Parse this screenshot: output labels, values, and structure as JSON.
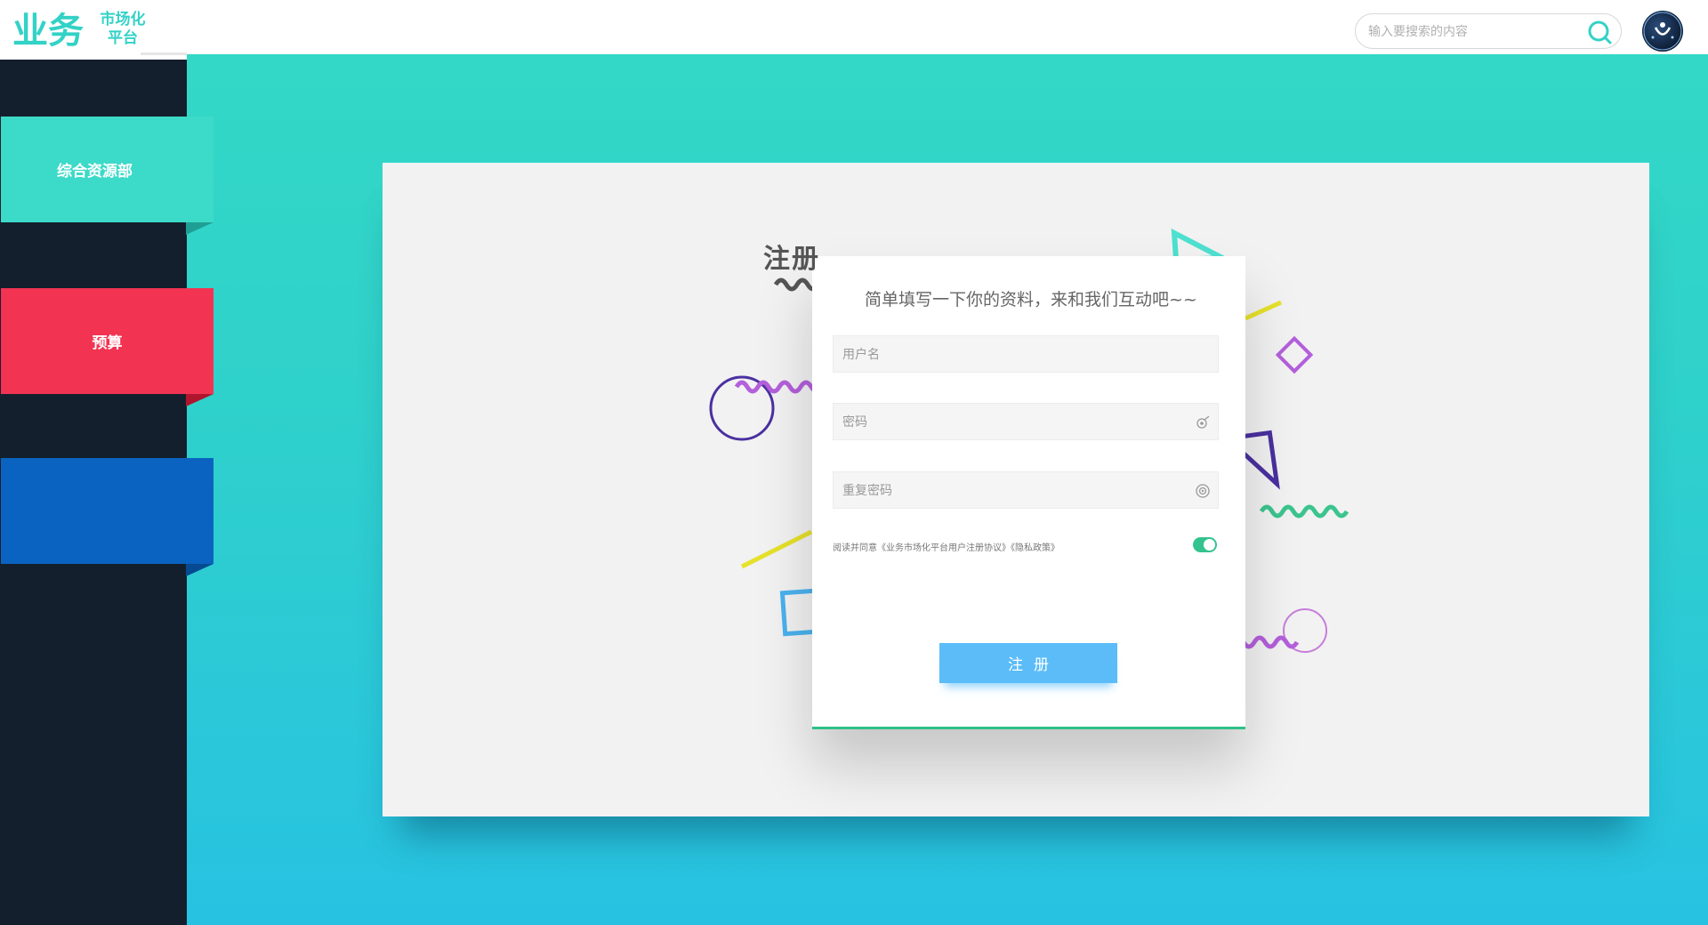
{
  "header": {
    "logo_mark": "业务",
    "logo_line1": "市场化",
    "logo_line2": "平台",
    "search_placeholder": "输入要搜索的内容"
  },
  "sidebar": {
    "items": [
      {
        "label": "综合资源部",
        "color": "#3cdac8"
      },
      {
        "label": "预算",
        "color": "#f23352"
      },
      {
        "label": "",
        "color": "#0a63c0"
      }
    ]
  },
  "form": {
    "title": "注册",
    "subtitle": "简单填写一下你的资料，来和我们互动吧~~",
    "username_placeholder": "用户名",
    "password_placeholder": "密码",
    "confirm_placeholder": "重复密码",
    "agreement": "阅读并同意《业务市场化平台用户注册协议》《隐私政策》",
    "agree_toggle": "on",
    "submit_label": "注册"
  },
  "colors": {
    "accent_teal": "#33d2c6",
    "sidebar_bg": "#141f2d",
    "submit_blue": "#5bbcf8",
    "toggle_green": "#34c38f"
  }
}
